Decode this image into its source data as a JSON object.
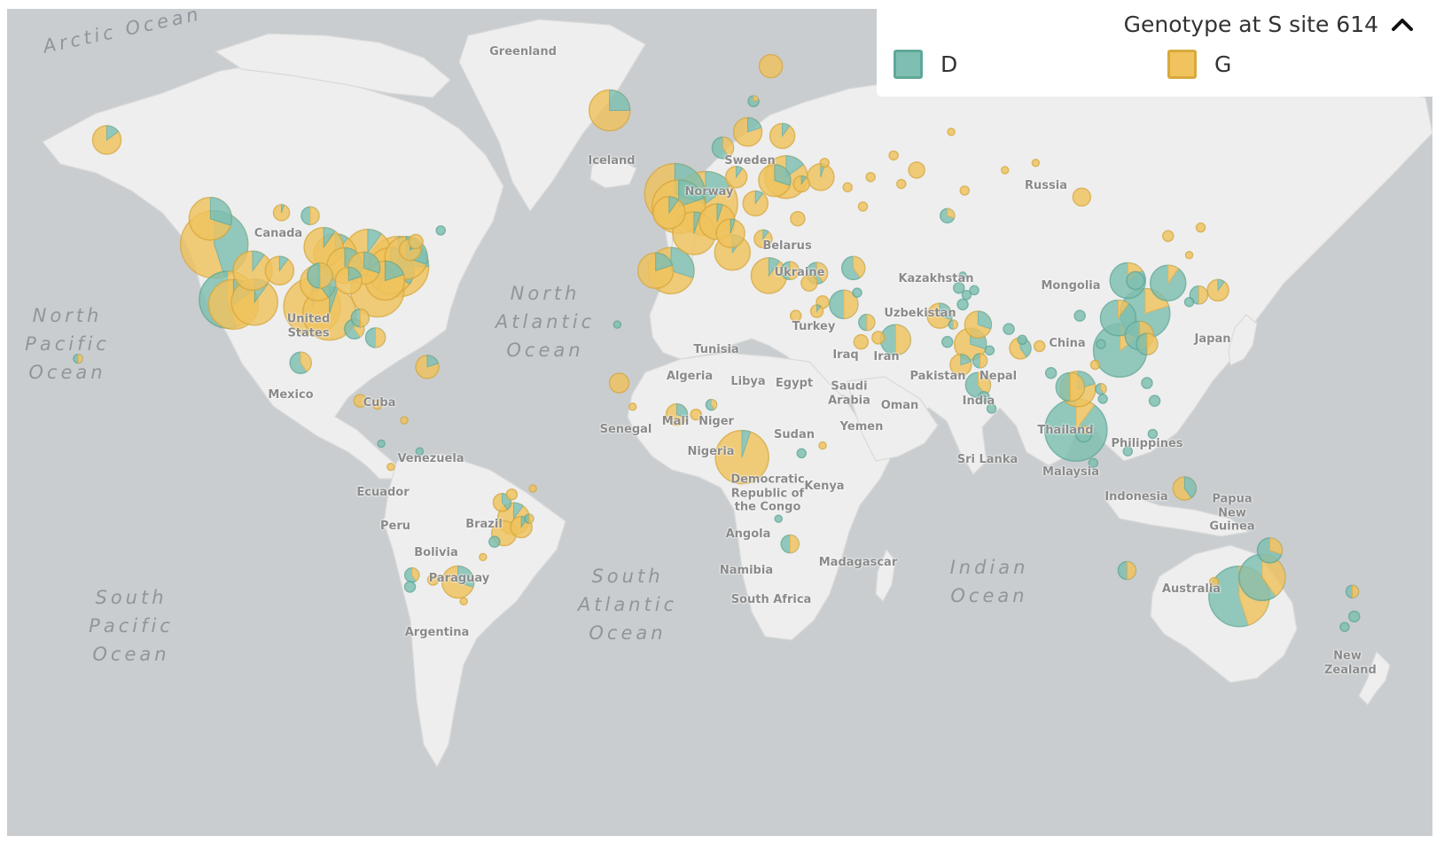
{
  "legend": {
    "title": "Genotype at S site 614",
    "items": [
      {
        "label": "D",
        "color": "#7fbfb1",
        "stroke": "#5fa899"
      },
      {
        "label": "G",
        "color": "#f0c35e",
        "stroke": "#d9a93c"
      }
    ],
    "toggle_icon": "chevron-up-icon"
  },
  "oceans": [
    {
      "lines": [
        "Arctic Ocean"
      ]
    },
    {
      "lines": [
        "North",
        "Pacific",
        "Ocean"
      ]
    },
    {
      "lines": [
        "North",
        "Atlantic",
        "Ocean"
      ]
    },
    {
      "lines": [
        "South",
        "Pacific",
        "Ocean"
      ]
    },
    {
      "lines": [
        "South",
        "Atlantic",
        "Ocean"
      ]
    },
    {
      "lines": [
        "Indian",
        "Ocean"
      ]
    }
  ],
  "countries": [
    "Greenland",
    "Iceland",
    "Sweden",
    "Norway",
    "Russia",
    "Belarus",
    "Ukraine",
    "Kazakhstan",
    "Mongolia",
    "Uzbekistan",
    "China",
    "Canada",
    "United States",
    "Mexico",
    "Cuba",
    "Venezuela",
    "Ecuador",
    "Peru",
    "Brazil",
    "Bolivia",
    "Paraguay",
    "Argentina",
    "Tunisia",
    "Algeria",
    "Libya",
    "Egypt",
    "Turkey",
    "Iraq",
    "Iran",
    "Saudi Arabia",
    "Oman",
    "Yemen",
    "Pakistan",
    "Nepal",
    "India",
    "Sri Lanka",
    "Thailand",
    "Malaysia",
    "Philippines",
    "Indonesia",
    "Papua New Guinea",
    "Mali",
    "Niger",
    "Senegal",
    "Nigeria",
    "Sudan",
    "Democratic Republic of the Congo",
    "Kenya",
    "Angola",
    "Namibia",
    "Madagascar",
    "South Africa",
    "Australia",
    "New Zealand",
    "Japan"
  ],
  "samples": [
    {
      "lon": -150.0,
      "lat": 61.0,
      "r": 16,
      "d": 0.15
    },
    {
      "lon": -123.0,
      "lat": 49.5,
      "r": 24,
      "d": 0.3
    },
    {
      "lon": -122.0,
      "lat": 45.0,
      "r": 38,
      "d": 0.45
    },
    {
      "lon": -118.5,
      "lat": 34.0,
      "r": 32,
      "d": 0.55
    },
    {
      "lon": -117.0,
      "lat": 33.0,
      "r": 28,
      "d": 0.15
    },
    {
      "lon": -112.0,
      "lat": 40.0,
      "r": 22,
      "d": 0.1
    },
    {
      "lon": -111.5,
      "lat": 33.5,
      "r": 26,
      "d": 0.1
    },
    {
      "lon": -105.0,
      "lat": 40.0,
      "r": 16,
      "d": 0.1
    },
    {
      "lon": -104.5,
      "lat": 50.5,
      "r": 9,
      "d": 0.05
    },
    {
      "lon": -97.0,
      "lat": 50.0,
      "r": 10,
      "d": 0.5
    },
    {
      "lon": -96.5,
      "lat": 32.5,
      "r": 32,
      "d": 0.05
    },
    {
      "lon": -95.0,
      "lat": 37.5,
      "r": 20,
      "d": 0.4
    },
    {
      "lon": -94.5,
      "lat": 39.0,
      "r": 14,
      "d": 0.5
    },
    {
      "lon": -93.5,
      "lat": 44.5,
      "r": 22,
      "d": 0.1
    },
    {
      "lon": -92.0,
      "lat": 31.0,
      "r": 30,
      "d": 0.05
    },
    {
      "lon": -90.5,
      "lat": 43.0,
      "r": 24,
      "d": 0.1
    },
    {
      "lon": -88.0,
      "lat": 41.0,
      "r": 20,
      "d": 0.4
    },
    {
      "lon": -87.0,
      "lat": 38.0,
      "r": 15,
      "d": 0.2
    },
    {
      "lon": -85.5,
      "lat": 27.5,
      "r": 11,
      "d": 0.6
    },
    {
      "lon": -84.0,
      "lat": 30.0,
      "r": 10,
      "d": 0.5
    },
    {
      "lon": -83.0,
      "lat": 40.5,
      "r": 18,
      "d": 0.3
    },
    {
      "lon": -82.0,
      "lat": 43.5,
      "r": 26,
      "d": 0.1
    },
    {
      "lon": -80.0,
      "lat": 25.5,
      "r": 11,
      "d": 0.5
    },
    {
      "lon": -79.5,
      "lat": 36.0,
      "r": 30,
      "d": 0.1
    },
    {
      "lon": -77.5,
      "lat": 38.0,
      "r": 22,
      "d": 0.2
    },
    {
      "lon": -76.0,
      "lat": 40.0,
      "r": 26,
      "d": 0.35
    },
    {
      "lon": -74.0,
      "lat": 40.8,
      "r": 34,
      "d": 0.25
    },
    {
      "lon": -72.0,
      "lat": 42.5,
      "r": 24,
      "d": 0.3
    },
    {
      "lon": -71.0,
      "lat": 44.0,
      "r": 12,
      "d": 0.2
    },
    {
      "lon": -69.5,
      "lat": 45.5,
      "r": 8,
      "d": 0.0
    },
    {
      "lon": -63.0,
      "lat": 47.5,
      "r": 5,
      "d": 1.0
    },
    {
      "lon": -157.5,
      "lat": 20.5,
      "r": 5,
      "d": 0.5
    },
    {
      "lon": -99.5,
      "lat": 19.5,
      "r": 12,
      "d": 0.6
    },
    {
      "lon": -66.5,
      "lat": 18.5,
      "r": 13,
      "d": 0.2
    },
    {
      "lon": -84.0,
      "lat": 10.0,
      "r": 7,
      "d": 0.0
    },
    {
      "lon": -79.5,
      "lat": 9.0,
      "r": 5,
      "d": 0.0
    },
    {
      "lon": -72.5,
      "lat": 5.0,
      "r": 4,
      "d": 0.0
    },
    {
      "lon": -78.5,
      "lat": -1.0,
      "r": 4,
      "d": 1.0
    },
    {
      "lon": -76.0,
      "lat": -7.0,
      "r": 4,
      "d": 0.0
    },
    {
      "lon": -68.5,
      "lat": -3.0,
      "r": 4,
      "d": 1.0
    },
    {
      "lon": -47.0,
      "lat": -16.0,
      "r": 10,
      "d": 0.4
    },
    {
      "lon": -44.0,
      "lat": -20.0,
      "r": 18,
      "d": 0.1
    },
    {
      "lon": -42.0,
      "lat": -22.0,
      "r": 12,
      "d": 0.1
    },
    {
      "lon": -46.5,
      "lat": -23.5,
      "r": 14,
      "d": 0.0
    },
    {
      "lon": -40.0,
      "lat": -20.0,
      "r": 5,
      "d": 0.5
    },
    {
      "lon": -44.5,
      "lat": -14.0,
      "r": 6,
      "d": 0.0
    },
    {
      "lon": -39.0,
      "lat": -12.5,
      "r": 4,
      "d": 0.0
    },
    {
      "lon": -49.0,
      "lat": -25.5,
      "r": 6,
      "d": 1.0
    },
    {
      "lon": -52.0,
      "lat": -29.0,
      "r": 4,
      "d": 0.0
    },
    {
      "lon": -70.5,
      "lat": -33.0,
      "r": 8,
      "d": 0.6
    },
    {
      "lon": -71.0,
      "lat": -35.5,
      "r": 6,
      "d": 1.0
    },
    {
      "lon": -58.5,
      "lat": -34.5,
      "r": 18,
      "d": 0.3
    },
    {
      "lon": -65.0,
      "lat": -34.0,
      "r": 6,
      "d": 0.0
    },
    {
      "lon": -57.0,
      "lat": -38.5,
      "r": 4,
      "d": 0.0
    },
    {
      "lon": -19.0,
      "lat": 64.5,
      "r": 23,
      "d": 0.25
    },
    {
      "lon": -2.0,
      "lat": 53.5,
      "r": 34,
      "d": 0.3
    },
    {
      "lon": -1.0,
      "lat": 51.5,
      "r": 30,
      "d": 0.2
    },
    {
      "lon": -3.5,
      "lat": 50.5,
      "r": 18,
      "d": 0.1
    },
    {
      "lon": 6.0,
      "lat": 52.0,
      "r": 36,
      "d": 0.15
    },
    {
      "lon": 3.0,
      "lat": 47.0,
      "r": 24,
      "d": 0.05
    },
    {
      "lon": 9.0,
      "lat": 49.0,
      "r": 20,
      "d": 0.05
    },
    {
      "lon": 12.5,
      "lat": 47.0,
      "r": 16,
      "d": 0.05
    },
    {
      "lon": 13.0,
      "lat": 43.5,
      "r": 20,
      "d": 0.1
    },
    {
      "lon": -7.0,
      "lat": 40.0,
      "r": 20,
      "d": 0.2
    },
    {
      "lon": -3.0,
      "lat": 40.0,
      "r": 26,
      "d": 0.3
    },
    {
      "lon": 10.5,
      "lat": 60.0,
      "r": 12,
      "d": 0.6
    },
    {
      "lon": 17.0,
      "lat": 62.0,
      "r": 16,
      "d": 0.2
    },
    {
      "lon": 18.5,
      "lat": 65.5,
      "r": 6,
      "d": 0.8
    },
    {
      "lon": 26.0,
      "lat": 61.5,
      "r": 14,
      "d": 0.1
    },
    {
      "lon": 23.0,
      "lat": 69.0,
      "r": 13,
      "d": 0.0
    },
    {
      "lon": 24.0,
      "lat": 55.5,
      "r": 18,
      "d": 0.3
    },
    {
      "lon": 27.0,
      "lat": 56.0,
      "r": 24,
      "d": 0.15
    },
    {
      "lon": 14.0,
      "lat": 56.0,
      "r": 12,
      "d": 0.1
    },
    {
      "lon": 19.0,
      "lat": 52.0,
      "r": 14,
      "d": 0.1
    },
    {
      "lon": 21.0,
      "lat": 46.0,
      "r": 10,
      "d": 0.1
    },
    {
      "lon": 31.0,
      "lat": 55.0,
      "r": 9,
      "d": 0.1
    },
    {
      "lon": 36.0,
      "lat": 56.0,
      "r": 15,
      "d": 0.05
    },
    {
      "lon": 30.0,
      "lat": 49.5,
      "r": 8,
      "d": 0.0
    },
    {
      "lon": 22.5,
      "lat": 39.0,
      "r": 20,
      "d": 0.1
    },
    {
      "lon": 28.0,
      "lat": 40.0,
      "r": 10,
      "d": 0.5
    },
    {
      "lon": 33.0,
      "lat": 37.5,
      "r": 9,
      "d": 0.0
    },
    {
      "lon": 35.0,
      "lat": 39.5,
      "r": 12,
      "d": 0.6
    },
    {
      "lon": 44.5,
      "lat": 40.5,
      "r": 13,
      "d": 0.6
    },
    {
      "lon": 36.5,
      "lat": 33.5,
      "r": 7,
      "d": 0.0
    },
    {
      "lon": 35.0,
      "lat": 31.5,
      "r": 7,
      "d": 0.1
    },
    {
      "lon": 42.0,
      "lat": 33.0,
      "r": 16,
      "d": 0.5
    },
    {
      "lon": 48.0,
      "lat": 29.0,
      "r": 9,
      "d": 0.5
    },
    {
      "lon": 46.5,
      "lat": 24.5,
      "r": 8,
      "d": 0.0
    },
    {
      "lon": 55.5,
      "lat": 25.0,
      "r": 17,
      "d": 0.5
    },
    {
      "lon": 51.0,
      "lat": 25.5,
      "r": 7,
      "d": 0.0
    },
    {
      "lon": 45.5,
      "lat": 35.5,
      "r": 5,
      "d": 1.0
    },
    {
      "lon": 29.5,
      "lat": 30.5,
      "r": 6,
      "d": 0.0
    },
    {
      "lon": -16.5,
      "lat": 14.5,
      "r": 11,
      "d": 0.0
    },
    {
      "lon": -17.0,
      "lat": 28.5,
      "r": 4,
      "d": 1.0
    },
    {
      "lon": -1.5,
      "lat": 6.5,
      "r": 12,
      "d": 0.3
    },
    {
      "lon": 7.5,
      "lat": 9.0,
      "r": 6,
      "d": 0.6
    },
    {
      "lon": 3.5,
      "lat": 6.5,
      "r": 6,
      "d": 0.0
    },
    {
      "lon": 15.5,
      "lat": -4.5,
      "r": 30,
      "d": 0.05
    },
    {
      "lon": 31.0,
      "lat": -3.5,
      "r": 5,
      "d": 1.0
    },
    {
      "lon": 36.5,
      "lat": -1.5,
      "r": 4,
      "d": 0.0
    },
    {
      "lon": 28.0,
      "lat": -26.0,
      "r": 10,
      "d": 0.5
    },
    {
      "lon": 25.0,
      "lat": -20.0,
      "r": 4,
      "d": 1.0
    },
    {
      "lon": -13.0,
      "lat": 8.5,
      "r": 4,
      "d": 0.0
    },
    {
      "lon": 37.0,
      "lat": 58.0,
      "r": 5,
      "d": 0.0
    },
    {
      "lon": 43.0,
      "lat": 54.5,
      "r": 5,
      "d": 0.0
    },
    {
      "lon": 49.0,
      "lat": 56.0,
      "r": 5,
      "d": 0.0
    },
    {
      "lon": 55.0,
      "lat": 59.0,
      "r": 5,
      "d": 0.0
    },
    {
      "lon": 61.0,
      "lat": 57.0,
      "r": 9,
      "d": 0.0
    },
    {
      "lon": 70.0,
      "lat": 62.0,
      "r": 4,
      "d": 0.0
    },
    {
      "lon": 73.5,
      "lat": 54.0,
      "r": 5,
      "d": 0.0
    },
    {
      "lon": 84.0,
      "lat": 57.0,
      "r": 4,
      "d": 0.0
    },
    {
      "lon": 92.0,
      "lat": 58.0,
      "r": 4,
      "d": 0.0
    },
    {
      "lon": 104.0,
      "lat": 53.0,
      "r": 10,
      "d": 0.0
    },
    {
      "lon": 115.0,
      "lat": 68.0,
      "r": 4,
      "d": 0.0
    },
    {
      "lon": 135.0,
      "lat": 70.5,
      "r": 8,
      "d": 0.0
    },
    {
      "lon": 47.0,
      "lat": 51.5,
      "r": 5,
      "d": 0.0
    },
    {
      "lon": 57.0,
      "lat": 55.0,
      "r": 5,
      "d": 0.0
    },
    {
      "lon": 69.0,
      "lat": 50.0,
      "r": 8,
      "d": 0.7
    },
    {
      "lon": 126.5,
      "lat": 46.5,
      "r": 6,
      "d": 0.0
    },
    {
      "lon": 135.0,
      "lat": 48.0,
      "r": 5,
      "d": 0.0
    },
    {
      "lon": 132.0,
      "lat": 43.0,
      "r": 4,
      "d": 0.0
    },
    {
      "lon": 67.0,
      "lat": 30.5,
      "r": 14,
      "d": 0.3
    },
    {
      "lon": 69.0,
      "lat": 24.5,
      "r": 6,
      "d": 1.0
    },
    {
      "lon": 70.5,
      "lat": 28.5,
      "r": 5,
      "d": 0.5
    },
    {
      "lon": 77.0,
      "lat": 28.5,
      "r": 15,
      "d": 0.3
    },
    {
      "lon": 75.0,
      "lat": 24.0,
      "r": 18,
      "d": 0.3
    },
    {
      "lon": 77.5,
      "lat": 20.0,
      "r": 8,
      "d": 0.5
    },
    {
      "lon": 72.5,
      "lat": 19.0,
      "r": 12,
      "d": 0.2
    },
    {
      "lon": 77.0,
      "lat": 14.0,
      "r": 14,
      "d": 0.6
    },
    {
      "lon": 78.5,
      "lat": 11.0,
      "r": 6,
      "d": 1.0
    },
    {
      "lon": 85.0,
      "lat": 27.5,
      "r": 6,
      "d": 1.0
    },
    {
      "lon": 88.0,
      "lat": 23.0,
      "r": 12,
      "d": 0.4
    },
    {
      "lon": 73.0,
      "lat": 33.0,
      "r": 6,
      "d": 1.0
    },
    {
      "lon": 72.0,
      "lat": 36.5,
      "r": 6,
      "d": 1.0
    },
    {
      "lon": 73.0,
      "lat": 39.0,
      "r": 4,
      "d": 1.0
    },
    {
      "lon": 80.5,
      "lat": 8.0,
      "r": 5,
      "d": 1.0
    },
    {
      "lon": 74.0,
      "lat": 35.0,
      "r": 5,
      "d": 1.0
    },
    {
      "lon": 76.0,
      "lat": 36.0,
      "r": 5,
      "d": 1.0
    },
    {
      "lon": 80.0,
      "lat": 22.5,
      "r": 5,
      "d": 1.0
    },
    {
      "lon": 93.0,
      "lat": 23.5,
      "r": 6,
      "d": 0.0
    },
    {
      "lon": 88.5,
      "lat": 25.0,
      "r": 5,
      "d": 1.0
    },
    {
      "lon": 101.0,
      "lat": 13.5,
      "r": 16,
      "d": 0.5
    },
    {
      "lon": 103.0,
      "lat": 13.0,
      "r": 20,
      "d": 0.2
    },
    {
      "lon": 102.5,
      "lat": 2.5,
      "r": 35,
      "d": 0.9
    },
    {
      "lon": 104.5,
      "lat": 1.5,
      "r": 9,
      "d": 0.8
    },
    {
      "lon": 107.0,
      "lat": -6.0,
      "r": 5,
      "d": 1.0
    },
    {
      "lon": 109.0,
      "lat": 13.0,
      "r": 6,
      "d": 0.6
    },
    {
      "lon": 107.5,
      "lat": 19.0,
      "r": 5,
      "d": 0.0
    },
    {
      "lon": 109.5,
      "lat": 10.5,
      "r": 5,
      "d": 1.0
    },
    {
      "lon": 114.0,
      "lat": 22.5,
      "r": 30,
      "d": 0.85
    },
    {
      "lon": 113.5,
      "lat": 30.0,
      "r": 20,
      "d": 0.9
    },
    {
      "lon": 116.0,
      "lat": 38.0,
      "r": 20,
      "d": 0.85
    },
    {
      "lon": 120.5,
      "lat": 31.0,
      "r": 28,
      "d": 0.8
    },
    {
      "lon": 119.0,
      "lat": 26.0,
      "r": 16,
      "d": 0.5
    },
    {
      "lon": 121.0,
      "lat": 24.0,
      "r": 12,
      "d": 0.5
    },
    {
      "lon": 126.5,
      "lat": 37.5,
      "r": 20,
      "d": 0.9
    },
    {
      "lon": 139.5,
      "lat": 36.0,
      "r": 12,
      "d": 0.1
    },
    {
      "lon": 134.5,
      "lat": 35.0,
      "r": 10,
      "d": 0.5
    },
    {
      "lon": 132.0,
      "lat": 33.5,
      "r": 5,
      "d": 1.0
    },
    {
      "lon": 118.0,
      "lat": 38.0,
      "r": 10,
      "d": 1.0
    },
    {
      "lon": 103.5,
      "lat": 30.5,
      "r": 6,
      "d": 1.0
    },
    {
      "lon": 109.0,
      "lat": 24.0,
      "r": 5,
      "d": 1.0
    },
    {
      "lon": 96.0,
      "lat": 17.0,
      "r": 6,
      "d": 1.0
    },
    {
      "lon": 121.0,
      "lat": 14.5,
      "r": 6,
      "d": 1.0
    },
    {
      "lon": 123.0,
      "lat": 10.0,
      "r": 6,
      "d": 1.0
    },
    {
      "lon": 116.0,
      "lat": -3.0,
      "r": 5,
      "d": 1.0
    },
    {
      "lon": 122.5,
      "lat": 1.5,
      "r": 5,
      "d": 1.0
    },
    {
      "lon": 115.8,
      "lat": -32.0,
      "r": 10,
      "d": 0.5
    },
    {
      "lon": 130.8,
      "lat": -12.5,
      "r": 13,
      "d": 0.4
    },
    {
      "lon": 153.0,
      "lat": -27.5,
      "r": 14,
      "d": 0.7
    },
    {
      "lon": 151.0,
      "lat": -33.5,
      "r": 26,
      "d": 0.6
    },
    {
      "lon": 145.0,
      "lat": -37.5,
      "r": 34,
      "d": 0.55
    },
    {
      "lon": 138.5,
      "lat": -34.5,
      "r": 5,
      "d": 0.0
    },
    {
      "lon": 174.5,
      "lat": -36.5,
      "r": 7,
      "d": 0.5
    },
    {
      "lon": 175.0,
      "lat": -41.5,
      "r": 6,
      "d": 1.0
    },
    {
      "lon": 172.5,
      "lat": -43.5,
      "r": 5,
      "d": 1.0
    }
  ]
}
